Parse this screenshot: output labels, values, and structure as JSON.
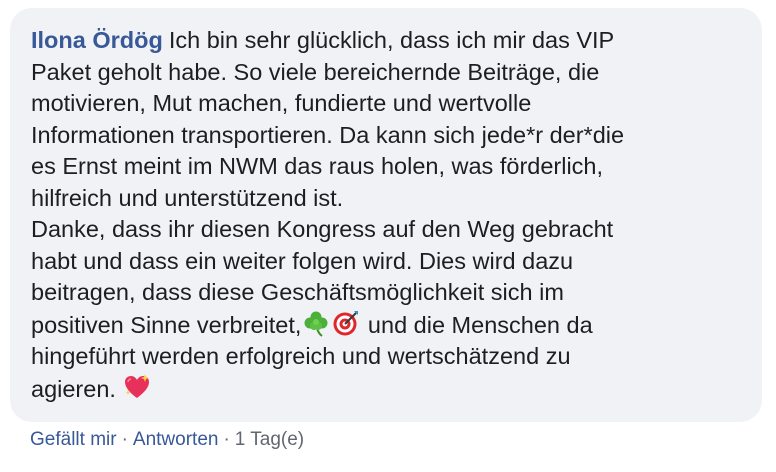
{
  "comment": {
    "author": "Ilona Ördög",
    "lines": [
      "Ich bin sehr glücklich, dass ich mir das VIP",
      "Paket geholt habe. So viele bereichernde Beiträge, die",
      "motivieren, Mut machen, fundierte und wertvolle",
      "Informationen transportieren. Da kann sich jede*r der*die",
      "es Ernst meint im NWM das raus holen, was förderlich,",
      "hilfreich und unterstützend ist.",
      "Danke, dass ihr diesen Kongress auf den Weg gebracht",
      "habt und dass ein weiter folgen wird. Dies wird dazu",
      "beitragen, dass diese Geschäftsmöglichkeit sich im"
    ],
    "line10_before": "positiven Sinne verbreitet,",
    "line10_after": " und die Menschen da",
    "line11": "hingeführt werden erfolgreich und wertschätzend zu",
    "line12": "agieren. ",
    "emojis": [
      "shamrock-icon",
      "direct-hit-icon",
      "sparkling-heart-icon"
    ]
  },
  "actions": {
    "like": "Gefällt mir",
    "separator": "·",
    "reply": "Antworten",
    "time": "1 Tag(e)"
  },
  "colors": {
    "bubble": "#f0f2f5",
    "author": "#385898",
    "text": "#1c1e21",
    "meta": "#606770"
  }
}
